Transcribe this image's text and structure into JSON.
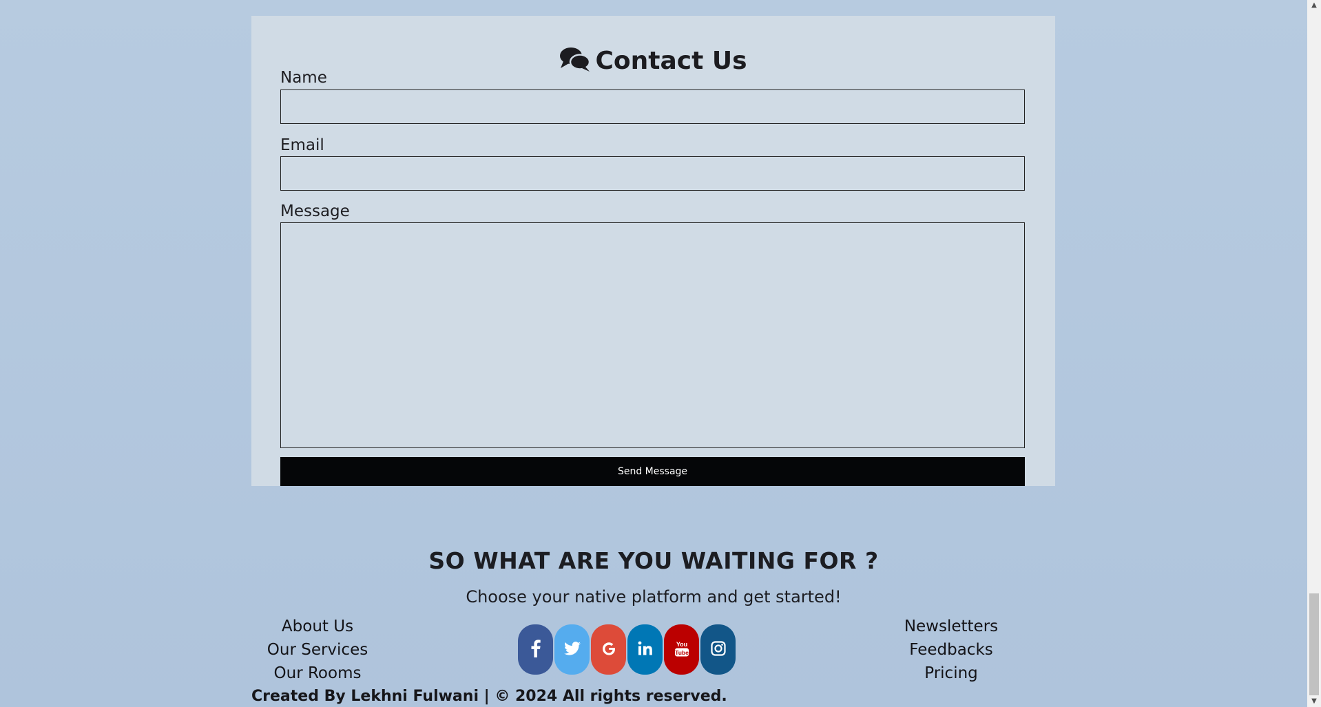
{
  "contact": {
    "title": "Contact Us",
    "title_icon": "comments-icon",
    "fields": {
      "name": {
        "label": "Name",
        "value": "",
        "placeholder": ""
      },
      "email": {
        "label": "Email",
        "value": "",
        "placeholder": ""
      },
      "message": {
        "label": "Message",
        "value": "",
        "placeholder": ""
      }
    },
    "send_label": "Send Message",
    "send_bg": "#050608",
    "card_bg": "#d0dbe5"
  },
  "footer": {
    "heading": "SO WHAT ARE YOU WAITING FOR ?",
    "subheading": "Choose your native platform and get started!",
    "left_links": [
      "About Us",
      "Our Services",
      "Our Rooms"
    ],
    "right_links": [
      "Newsletters",
      "Feedbacks",
      "Pricing"
    ],
    "social": [
      {
        "name": "facebook-icon",
        "glyph": "f",
        "color": "#3b5998"
      },
      {
        "name": "twitter-icon",
        "glyph": "bird",
        "color": "#55acee"
      },
      {
        "name": "google-icon",
        "glyph": "G",
        "color": "#dd4b39"
      },
      {
        "name": "linkedin-icon",
        "glyph": "in",
        "color": "#0077b5"
      },
      {
        "name": "youtube-icon",
        "glyph": "You Tube",
        "color": "#bb0000"
      },
      {
        "name": "instagram-icon",
        "glyph": "camera",
        "color": "#125688"
      }
    ],
    "copyright": "Created By Lekhni Fulwani | © 2024 All rights reserved."
  },
  "background": "#b3c7de"
}
